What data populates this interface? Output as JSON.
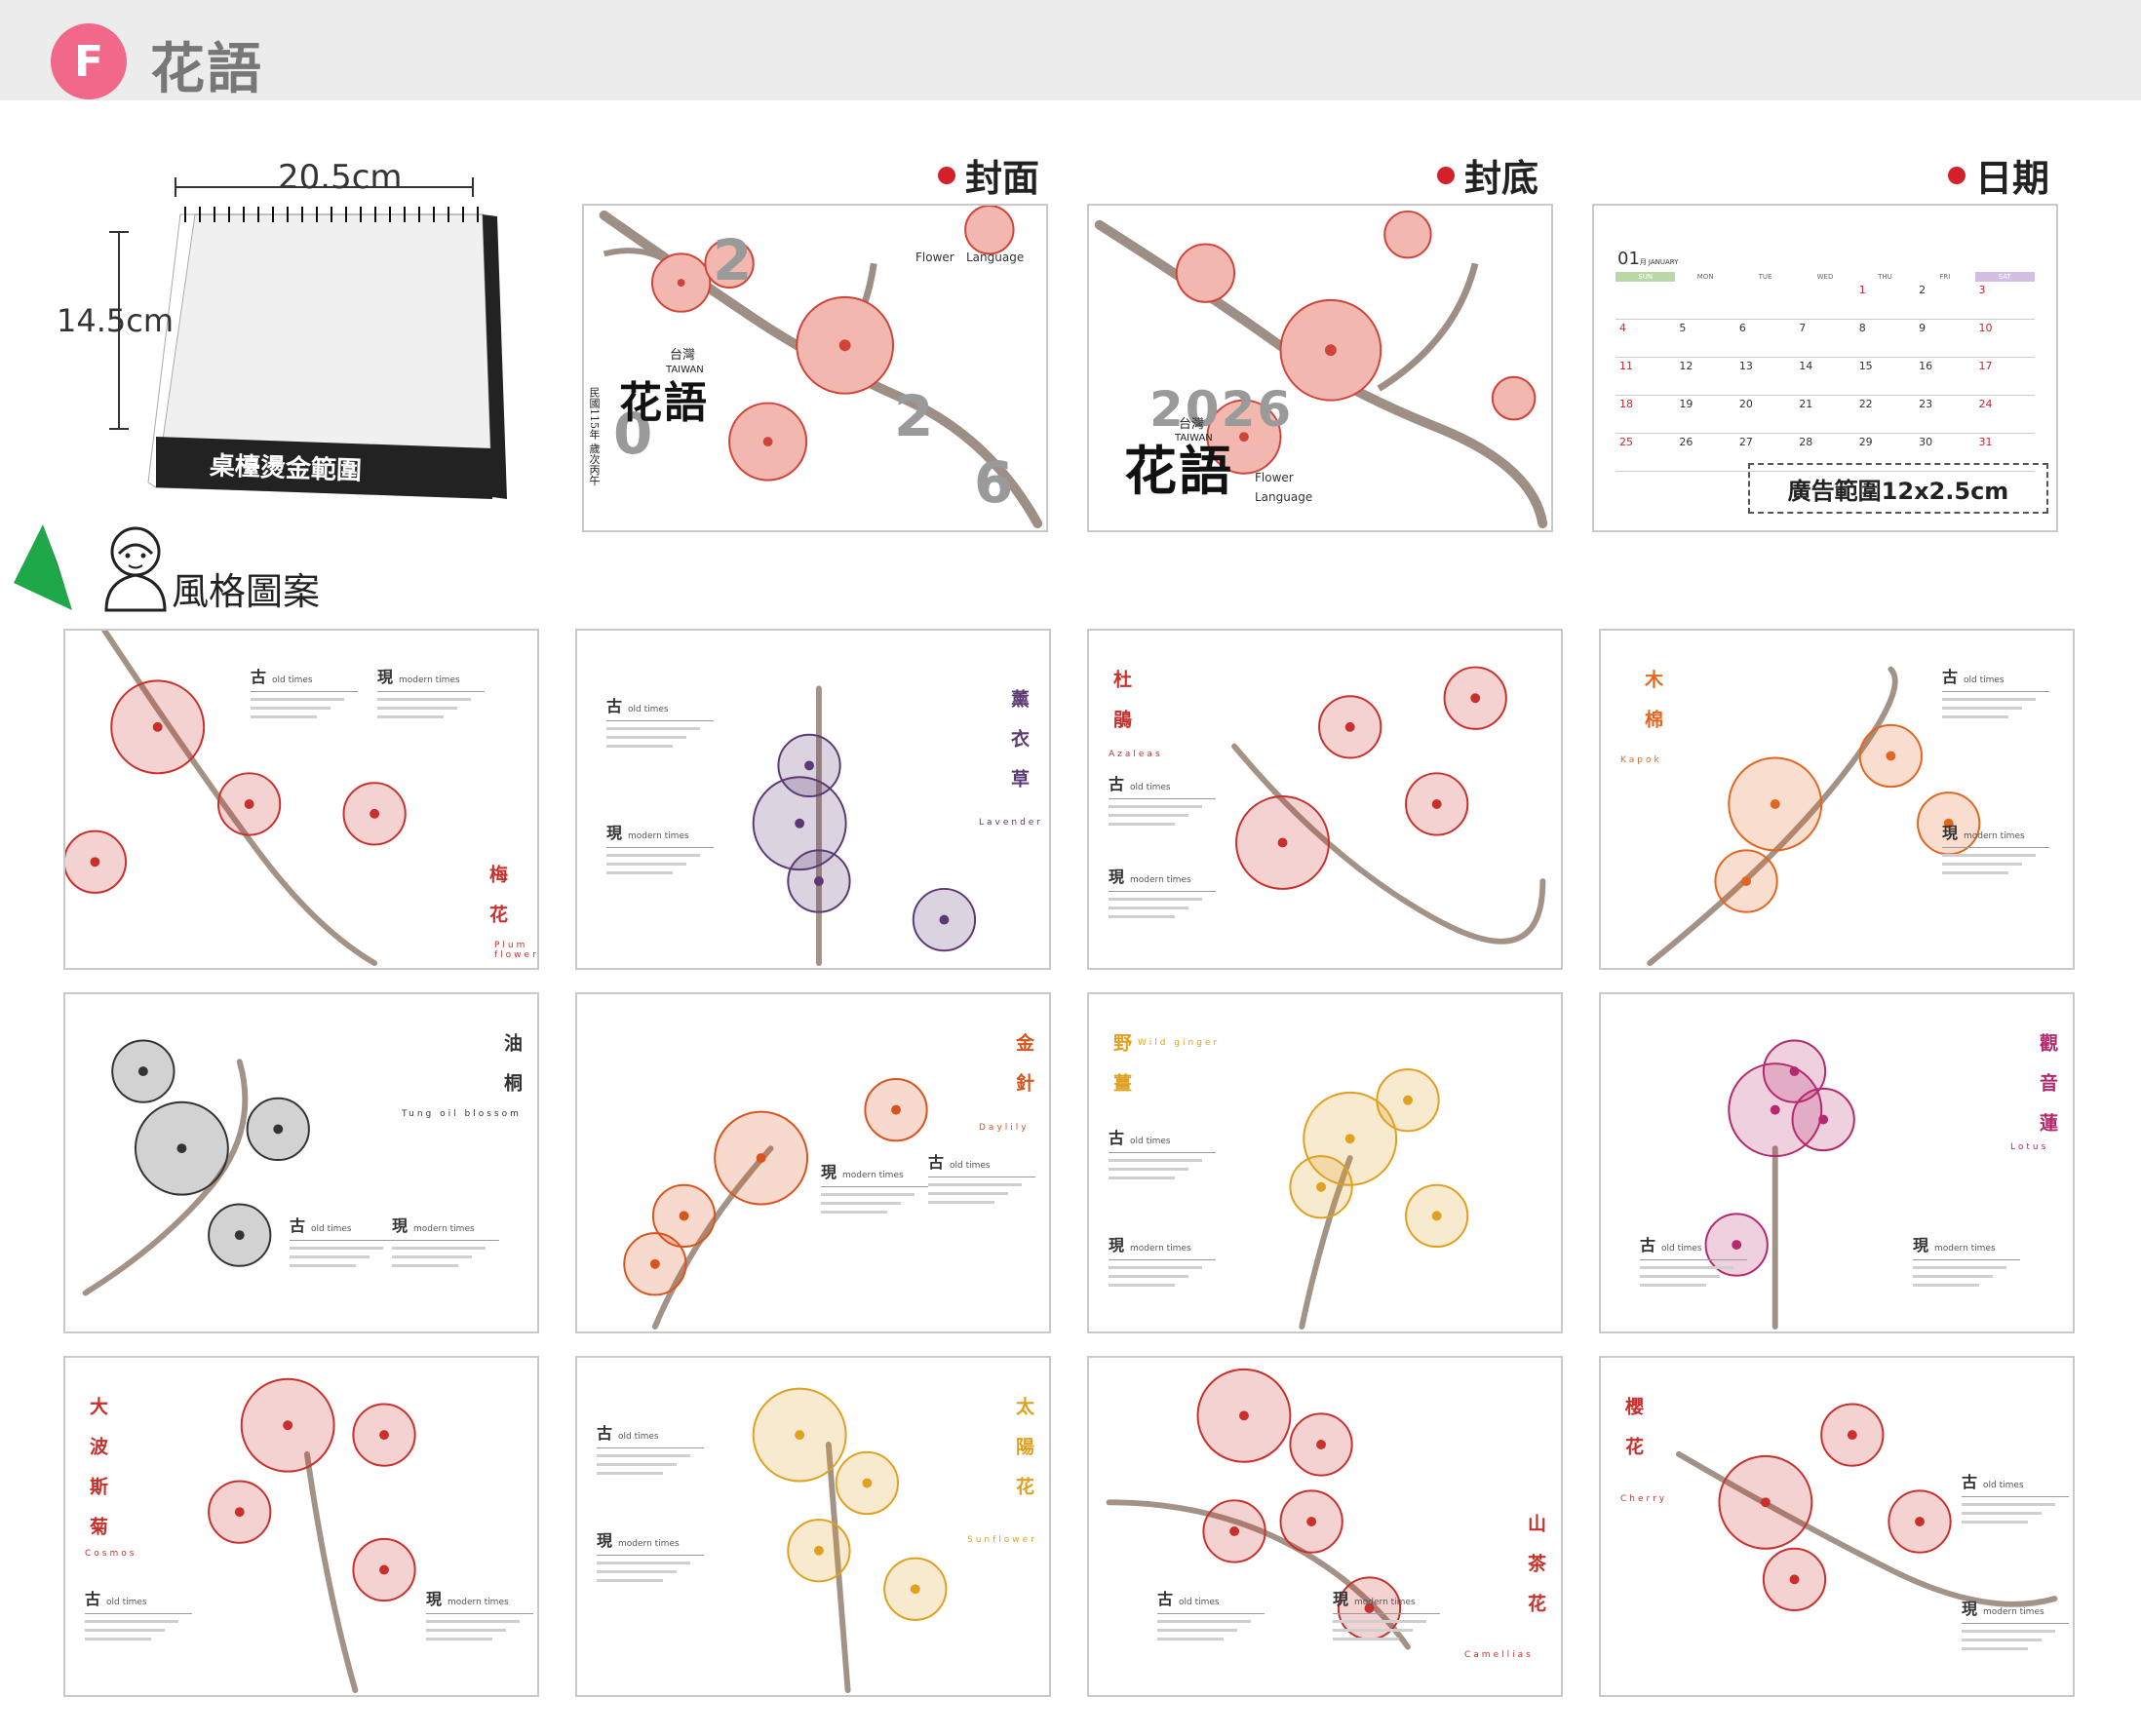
{
  "header": {
    "badge": "F",
    "title": "花語"
  },
  "product": {
    "width": "20.5cm",
    "height": "14.5cm",
    "base_label": "桌檯燙金範圍"
  },
  "style_label": "風格圖案",
  "cover": {
    "label": "封面",
    "flower": "Flower",
    "language": "Language",
    "taiwan_cn": "台灣",
    "taiwan": "TAIWAN",
    "title": "花語",
    "year_digits": [
      "2",
      "0",
      "2",
      "6"
    ],
    "roc": "民國115年 歲次丙午"
  },
  "back": {
    "label": "封底",
    "year": "2026",
    "taiwan_cn": "台灣",
    "taiwan": "TAIWAN",
    "title": "花語",
    "flower": "Flower",
    "language": "Language"
  },
  "date": {
    "label": "日期",
    "month": "01",
    "month_cn": "月",
    "month_en": "JANUARY",
    "days": [
      "SUN",
      "MON",
      "TUE",
      "WED",
      "THU",
      "FRI",
      "SAT"
    ],
    "weeks": [
      [
        "",
        "",
        "",
        "",
        "1",
        "2",
        "3"
      ],
      [
        "4",
        "5",
        "6",
        "7",
        "8",
        "9",
        "10"
      ],
      [
        "11",
        "12",
        "13",
        "14",
        "15",
        "16",
        "17"
      ],
      [
        "18",
        "19",
        "20",
        "21",
        "22",
        "23",
        "24"
      ],
      [
        "25",
        "26",
        "27",
        "28",
        "29",
        "30",
        "31"
      ]
    ],
    "ad": "廣告範圍12x2.5cm"
  },
  "sections": {
    "old": "古",
    "old_en": "old times",
    "new": "現",
    "new_en": "modern times"
  },
  "pages": [
    {
      "name": "梅花",
      "en": "Plum flower",
      "color": "#c9302c"
    },
    {
      "name": "薰衣草",
      "en": "Lavender",
      "color": "#5b3a73"
    },
    {
      "name": "杜鵑",
      "en": "Azaleas",
      "color": "#c9302c"
    },
    {
      "name": "木棉",
      "en": "Kapok",
      "color": "#e2661f"
    },
    {
      "name": "油桐",
      "en": "Tung oil blossom",
      "color": "#333333"
    },
    {
      "name": "金針",
      "en": "Daylily",
      "color": "#d9541c"
    },
    {
      "name": "野薑",
      "en": "Wild ginger",
      "color": "#e0a020"
    },
    {
      "name": "觀音蓮",
      "en": "Lotus",
      "color": "#b5286d"
    },
    {
      "name": "大波斯菊",
      "en": "Cosmos",
      "color": "#c9302c"
    },
    {
      "name": "太陽花",
      "en": "Sunflower",
      "color": "#e0a020"
    },
    {
      "name": "山茶花",
      "en": "Camellias",
      "color": "#c9302c"
    },
    {
      "name": "櫻花",
      "en": "Cherry",
      "color": "#c9302c"
    }
  ]
}
